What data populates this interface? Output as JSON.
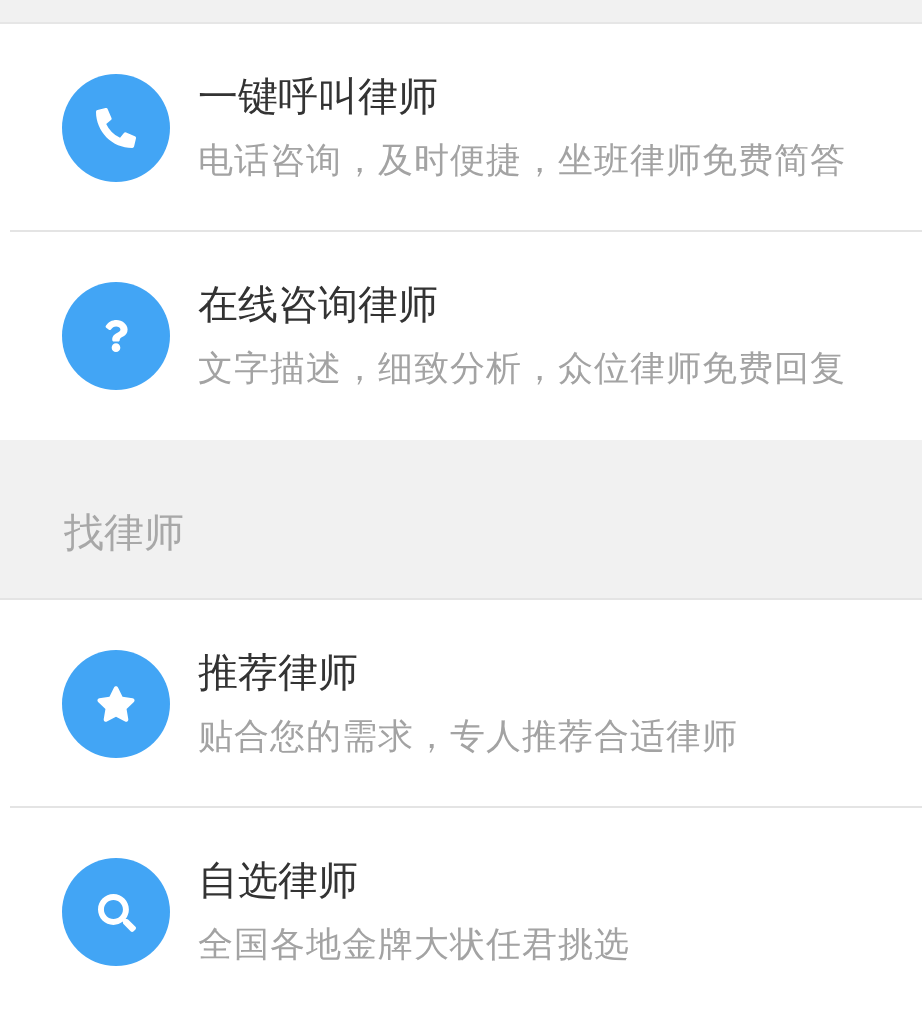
{
  "sections": [
    {
      "items": [
        {
          "title": "一键呼叫律师",
          "subtitle": "电话咨询，及时便捷，坐班律师免费简答"
        },
        {
          "title": "在线咨询律师",
          "subtitle": "文字描述，细致分析，众位律师免费回复"
        }
      ]
    },
    {
      "header": "找律师",
      "items": [
        {
          "title": "推荐律师",
          "subtitle": "贴合您的需求，专人推荐合适律师"
        },
        {
          "title": "自选律师",
          "subtitle": "全国各地金牌大状任君挑选"
        }
      ]
    }
  ]
}
